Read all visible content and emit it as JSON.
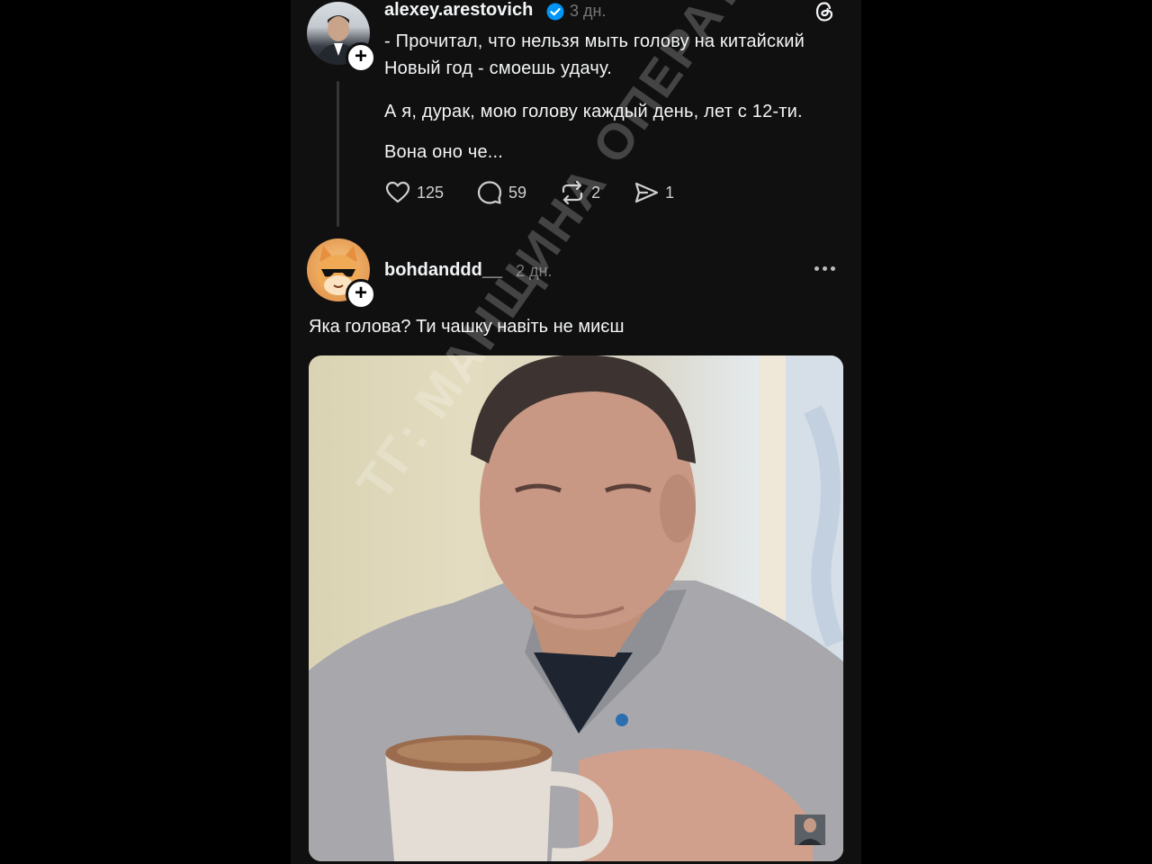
{
  "post": {
    "username": "alexey.arestovich",
    "time": "3 дн.",
    "paragraphs": [
      "- Прочитал, что нельзя мыть голову на китайский",
      "Новый год - смоешь удачу.",
      "А я, дурак, мою голову каждый день, лет с 12-ти.",
      "Вона оно че..."
    ],
    "likes": "125",
    "comments": "59",
    "reposts": "2",
    "shares": "1"
  },
  "reply": {
    "username": "bohdanddd__",
    "time": "2 дн.",
    "text": "Яка голова? Ти чашку навіть не миєш"
  },
  "watermark": "ТГ: МАНЩИНА ОПЕРАТИВНА",
  "icons": {
    "post_like": "heart-icon",
    "post_comment": "comment-icon",
    "post_repost": "repost-icon",
    "post_share": "share-icon",
    "app_logo": "threads-logo-icon",
    "verified": "verified-badge-icon",
    "follow": "plus-icon",
    "more": "more-dots-icon"
  },
  "colors": {
    "background": "#101010",
    "text": "#f3f5f7",
    "muted": "#777777",
    "verified": "#0095f6"
  }
}
